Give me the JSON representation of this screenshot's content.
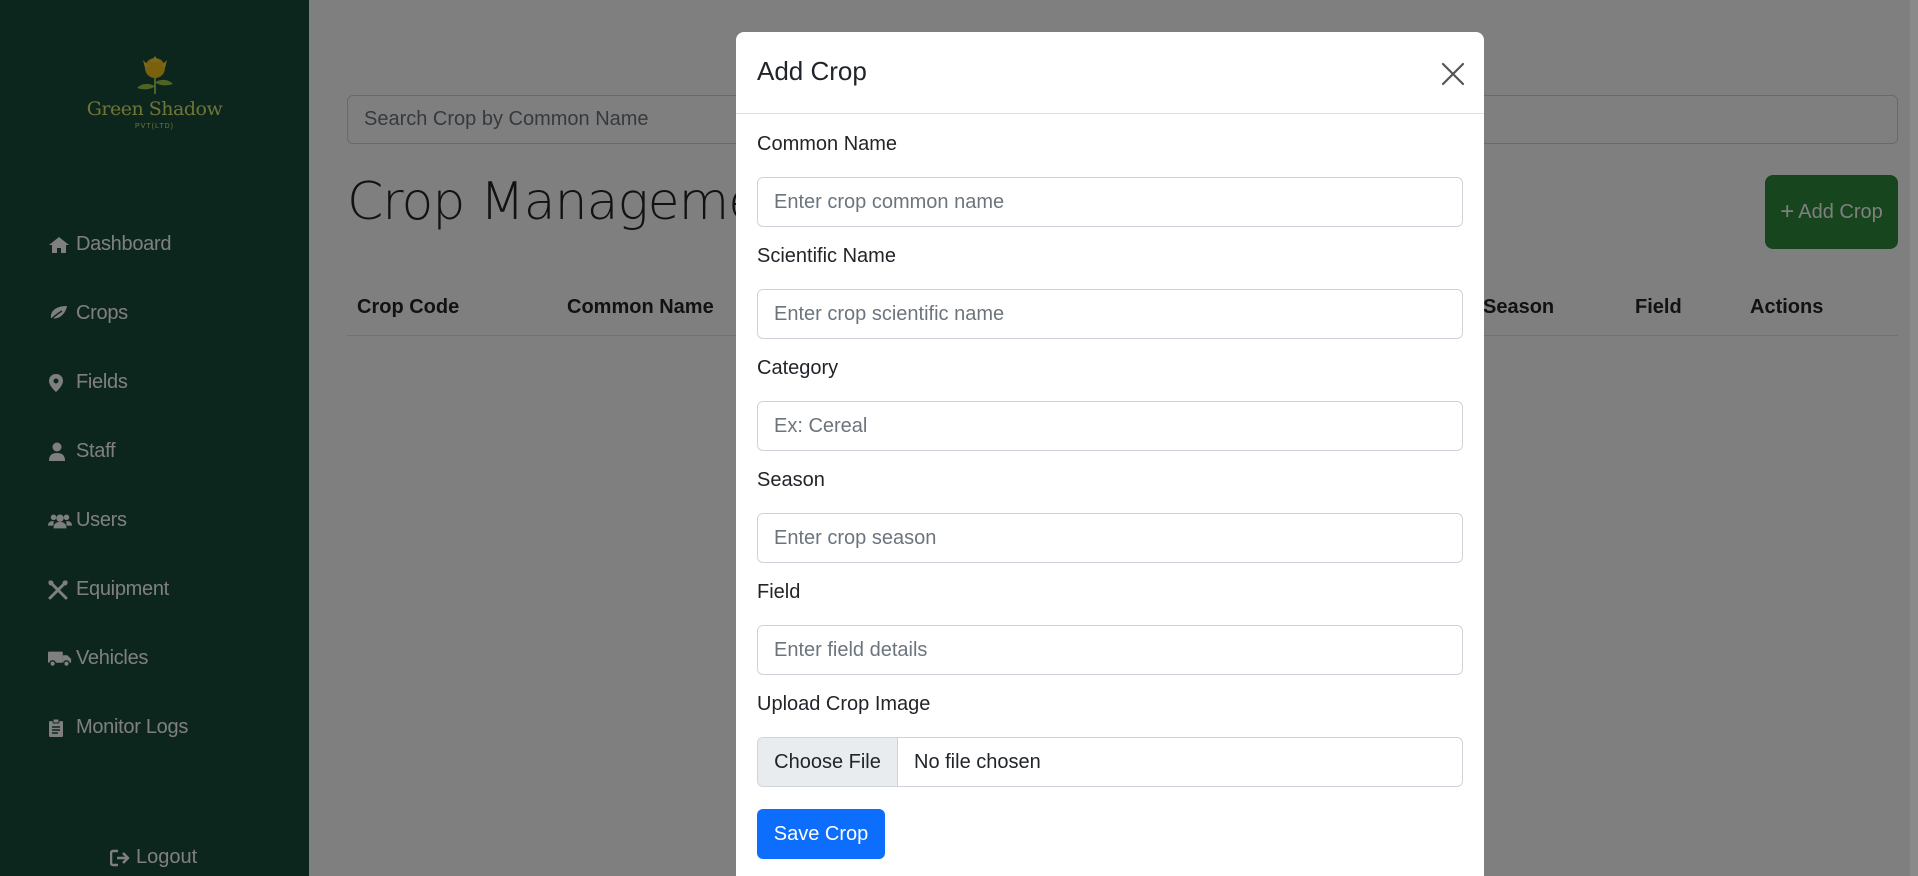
{
  "brand": {
    "name": "Green Shadow",
    "subtitle": "PVT(LTD)"
  },
  "sidebar": {
    "items": [
      {
        "label": "Dashboard",
        "icon": "home-icon"
      },
      {
        "label": "Crops",
        "icon": "leaf-icon"
      },
      {
        "label": "Fields",
        "icon": "map-marker-icon"
      },
      {
        "label": "Staff",
        "icon": "user-icon"
      },
      {
        "label": "Users",
        "icon": "users-icon"
      },
      {
        "label": "Equipment",
        "icon": "tools-icon"
      },
      {
        "label": "Vehicles",
        "icon": "truck-icon"
      },
      {
        "label": "Monitor Logs",
        "icon": "clipboard-icon"
      }
    ],
    "logout_label": "Logout"
  },
  "main": {
    "search_placeholder": "Search Crop by Common Name",
    "title": "Crop Management",
    "add_button_label": "Add Crop",
    "table_headers": [
      "Crop Code",
      "Common Name",
      "Season",
      "Field",
      "Actions"
    ]
  },
  "modal": {
    "title": "Add Crop",
    "fields": [
      {
        "label": "Common Name",
        "placeholder": "Enter crop common name"
      },
      {
        "label": "Scientific Name",
        "placeholder": "Enter crop scientific name"
      },
      {
        "label": "Category",
        "placeholder": "Ex: Cereal"
      },
      {
        "label": "Season",
        "placeholder": "Enter crop season"
      },
      {
        "label": "Field",
        "placeholder": "Enter field details"
      }
    ],
    "upload": {
      "label": "Upload Crop Image",
      "button_label": "Choose File",
      "status": "No file chosen"
    },
    "save_label": "Save Crop"
  },
  "colors": {
    "sidebar": "#1a4d3a",
    "accent_green": "#2e8b3a",
    "primary_blue": "#0d6efd",
    "logo": "#d9e86f"
  }
}
